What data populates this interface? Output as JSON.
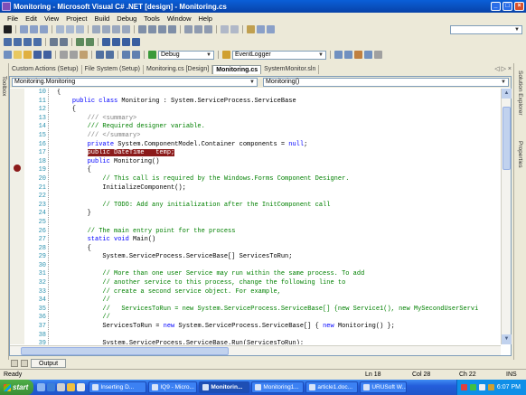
{
  "window": {
    "title": "Monitoring - Microsoft Visual C# .NET [design] - Monitoring.cs",
    "buttons": {
      "minimize": "_",
      "maximize": "□",
      "close": "×"
    }
  },
  "menu": [
    "File",
    "Edit",
    "View",
    "Project",
    "Build",
    "Debug",
    "Tools",
    "Window",
    "Help"
  ],
  "toolbar": {
    "config": "Debug",
    "target": "EventLogger"
  },
  "tabs": [
    "Custom Actions (Setup)",
    "File System (Setup)",
    "Monitoring.cs [Design]",
    "Monitoring.cs",
    "SystemMonitor.sln"
  ],
  "active_tab_index": 3,
  "tab_nav": "◁ ▷ ×",
  "nav": {
    "class_combo": "Monitoring.Monitoring",
    "member_combo": "Monitoring()"
  },
  "side": {
    "left": "Toolbox",
    "right_top": "Solution Explorer",
    "right_bottom": "Properties"
  },
  "code": {
    "line_numbers": [
      "10",
      "11",
      "12",
      "13",
      "14",
      "15",
      "16",
      "17",
      "18",
      "19",
      "20",
      "21",
      "22",
      "23",
      "24",
      "25",
      "26",
      "27",
      "28",
      "29",
      "30",
      "31",
      "32",
      "33",
      "34",
      "35",
      "36",
      "37",
      "38",
      "39"
    ],
    "breakpoint_line": "17"
  },
  "output_tab": "Output",
  "status": {
    "message": "Ready",
    "line": "Ln 18",
    "col": "Col 28",
    "ch": "Ch 22",
    "mode": "INS"
  },
  "taskbar": {
    "start": "start",
    "buttons": [
      "Inserting D...",
      "IQ9 - Micro...",
      "Monitorin...",
      "Monitoring1...",
      "article1.doc...",
      "URUSoft W..."
    ],
    "active_index": 2,
    "clock": "6:07 PM"
  }
}
